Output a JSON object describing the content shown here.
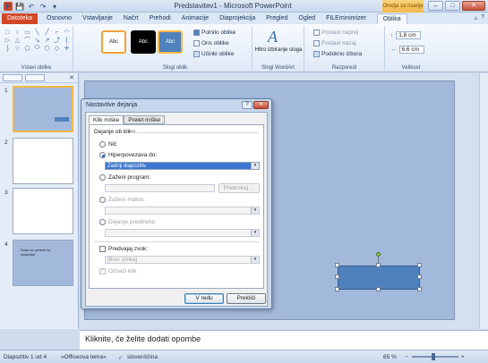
{
  "window": {
    "title": "Predstavitev1 - Microsoft PowerPoint",
    "context_tab_group": "Orodja za risanje",
    "minimize": "–",
    "maximize": "□",
    "close": "✕",
    "app_icon": "P",
    "qat": {
      "save": "💾",
      "undo": "↶",
      "redo": "↷",
      "customize": "▾"
    }
  },
  "tabs": [
    "Datoteka",
    "Osnovno",
    "Vstavljanje",
    "Načrt",
    "Prehodi",
    "Animacije",
    "Diaprojekcija",
    "Pregled",
    "Ogled",
    "FILEminimizer",
    "Oblika"
  ],
  "tabs_right": {
    "collapse": "▵",
    "help": "?"
  },
  "ribbon": {
    "insert_shapes_label": "Vstavi oblike",
    "shape_glyphs": [
      "□",
      "○",
      "▭",
      "╲",
      "╱",
      "⌐",
      "◠",
      "▷",
      "△",
      "⌒",
      "↘",
      "↗",
      "⤴",
      "{",
      "}",
      "☆",
      "⬠",
      "⬭",
      "⬡",
      "◇",
      "✛"
    ],
    "shape_styles_label": "Slogi oblik",
    "style_thumbs": [
      "Abc",
      "Abc",
      "Abc"
    ],
    "fill": "Polnilo oblike",
    "outline": "Oris oblike",
    "effects": "Učinki oblike",
    "quick_styles": "Hitro izbiranje sloga",
    "wordart_label": "Slogi WordArt",
    "bring_forward": "Postavi naprej",
    "send_backward": "Postavi nazaj",
    "selection_pane": "Podokno izbora",
    "arrange_label": "Razporedi",
    "height": "1,8 cm",
    "width": "6,6 cm",
    "size_label": "Velikost"
  },
  "slides": [
    {
      "num": "1"
    },
    {
      "num": "2"
    },
    {
      "num": "3"
    },
    {
      "num": "4",
      "text": "Kada se preseli na naslednji"
    }
  ],
  "dialog": {
    "title": "Nastavitve dejanja",
    "help": "?",
    "close": "✕",
    "tab_click": "Klik miške",
    "tab_hover": "Prelet miške",
    "section": "Dejanje ob kliku",
    "none": "Nič",
    "hyperlink": "Hiperpovezava do:",
    "hyperlink_value": "Zadnji diapozitiv",
    "run_program": "Zaženi program:",
    "browse": "Prebrskaj ...",
    "run_macro": "Zaženi makro:",
    "object_action": "Dejanje predmeta:",
    "play_sound": "Predvajaj zvok:",
    "sound_value": "[Brez zvoka]",
    "highlight": "Označi klik",
    "ok": "V redu",
    "cancel": "Prekliči",
    "arrow": "▾",
    "check_mark": "✓"
  },
  "notes_placeholder": "Kliknite, če želite dodati opombe",
  "status": {
    "slide": "Diapozitiv 1 od 4",
    "theme": "»Officeova tema«",
    "language": "slovenščina",
    "zoom": "65 %",
    "zoom_minus": "−",
    "zoom_plus": "+"
  }
}
